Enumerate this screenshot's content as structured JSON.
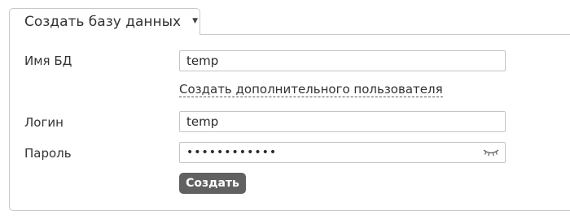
{
  "tab": {
    "label": "Создать базу данных"
  },
  "form": {
    "db_name_label": "Имя БД",
    "db_name_value": "temp",
    "create_user_link": "Создать дополнительного пользователя",
    "login_label": "Логин",
    "login_value": "temp",
    "password_label": "Пароль",
    "password_value": "••••••••••••",
    "submit_label": "Создать"
  },
  "colors": {
    "border": "#c9c9c9",
    "button_bg": "#616161",
    "button_text": "#ffffff",
    "text": "#333333"
  },
  "icons": {
    "dropdown": "caret-down-icon",
    "password_toggle": "eye-closed-icon"
  }
}
